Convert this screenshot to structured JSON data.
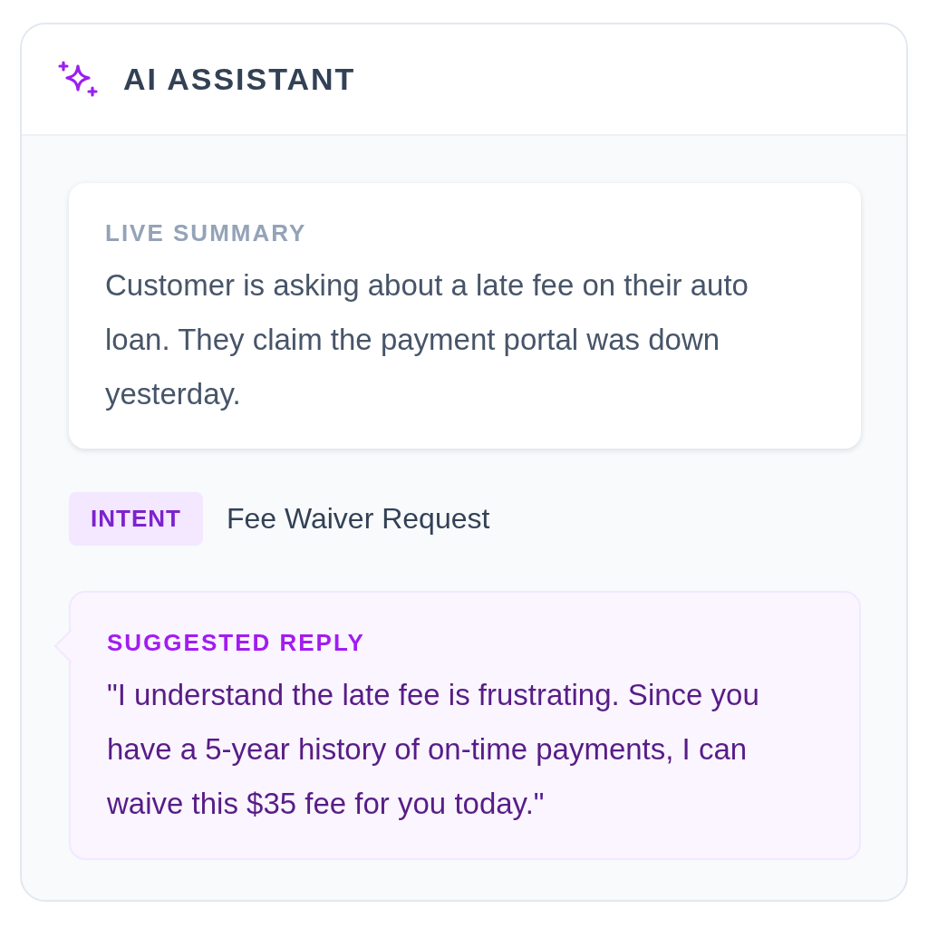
{
  "header": {
    "title": "AI ASSISTANT"
  },
  "summary": {
    "label": "LIVE SUMMARY",
    "text": "Customer is asking about a late fee on their auto loan. They claim the payment portal was down yesterday."
  },
  "intent": {
    "badge": "INTENT",
    "value": "Fee Waiver Request"
  },
  "suggestion": {
    "label": "SUGGESTED REPLY",
    "text": "\"I understand the late fee is frustrating. Since you have a 5-year history of on-time payments, I can waive this $35 fee for you today.\""
  }
}
